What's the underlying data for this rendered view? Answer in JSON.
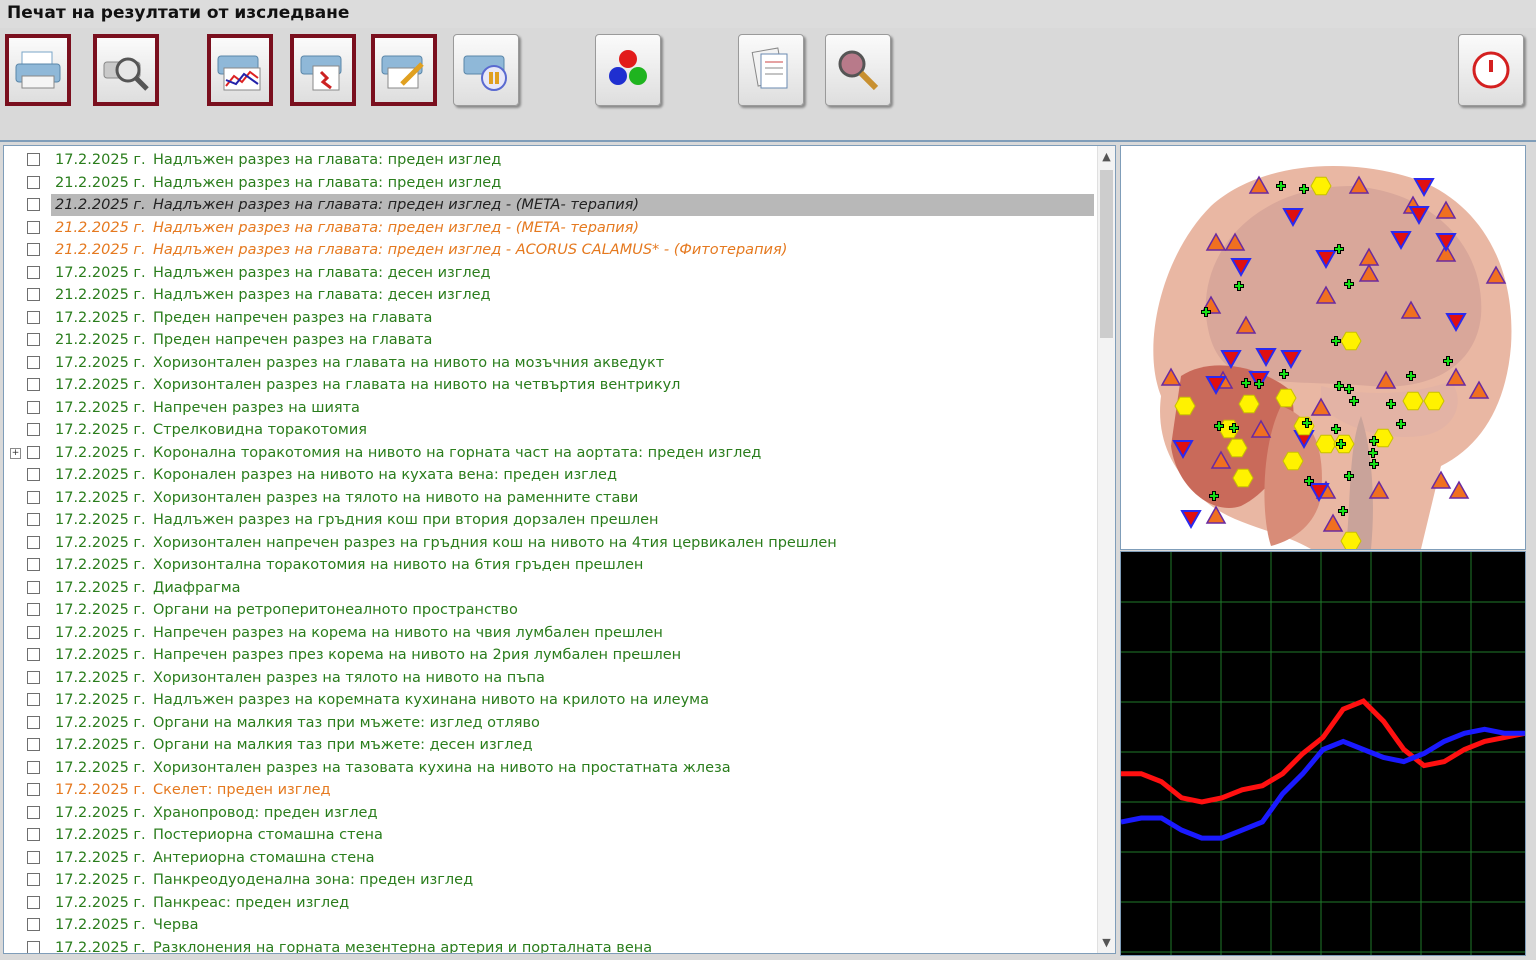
{
  "window": {
    "title": "Печат на резултати от изследване"
  },
  "toolbar": {
    "buttons": [
      {
        "name": "print-button",
        "icon": "printer-icon",
        "selected": true
      },
      {
        "name": "print-preview-button",
        "icon": "print-preview-icon",
        "selected": true
      },
      {
        "name": "print-chart-button",
        "icon": "print-chart-icon",
        "selected": true
      },
      {
        "name": "print-report-button",
        "icon": "print-report-icon",
        "selected": true
      },
      {
        "name": "print-edit-button",
        "icon": "print-edit-icon",
        "selected": true
      },
      {
        "name": "print-audio-button",
        "icon": "print-audio-icon",
        "selected": false
      },
      {
        "name": "color-spheres-button",
        "icon": "color-spheres-icon",
        "selected": false
      },
      {
        "name": "documents-button",
        "icon": "documents-icon",
        "selected": false
      },
      {
        "name": "search-button",
        "icon": "magnifier-icon",
        "selected": false
      },
      {
        "name": "exit-button",
        "icon": "power-icon",
        "selected": false
      }
    ]
  },
  "list": {
    "items": [
      {
        "date": "17.2.2025 г.",
        "label": "Надлъжен разрез на главата: преден изглед",
        "style": "green"
      },
      {
        "date": "21.2.2025 г.",
        "label": "Надлъжен разрез на главата: преден изглед",
        "style": "green"
      },
      {
        "date": "21.2.2025 г.",
        "label": "Надлъжен разрез на главата: преден изглед - (META- терапия)",
        "style": "selected"
      },
      {
        "date": "21.2.2025 г.",
        "label": "Надлъжен разрез на главата: преден изглед - (META- терапия)",
        "style": "orange"
      },
      {
        "date": "21.2.2025 г.",
        "label": "Надлъжен разрез на главата: преден изглед - ACORUS  CALAMUS* - (Фитотерапия)",
        "style": "orange"
      },
      {
        "date": "17.2.2025 г.",
        "label": "Надлъжен разрез на главата: десен изглед",
        "style": "green"
      },
      {
        "date": "21.2.2025 г.",
        "label": "Надлъжен разрез на главата: десен изглед",
        "style": "green"
      },
      {
        "date": "17.2.2025 г.",
        "label": "Преден напречен разрез на главата",
        "style": "green"
      },
      {
        "date": "21.2.2025 г.",
        "label": "Преден напречен разрез на главата",
        "style": "green"
      },
      {
        "date": "17.2.2025 г.",
        "label": "Хоризонтален разрез на главата на нивото на мозъчния акведукт",
        "style": "green"
      },
      {
        "date": "17.2.2025 г.",
        "label": "Хоризонтален разрез на главата на нивото на четвъртия вентрикул",
        "style": "green"
      },
      {
        "date": "17.2.2025 г.",
        "label": "Напречен разрез на шията",
        "style": "green"
      },
      {
        "date": "17.2.2025 г.",
        "label": "Стрелковидна торакотомия",
        "style": "green"
      },
      {
        "date": "17.2.2025 г.",
        "label": "Коронална торакотомия на нивото на горната част на аортата: преден изглед",
        "style": "green",
        "expand": "+"
      },
      {
        "date": "17.2.2025 г.",
        "label": "Коронален разрез на нивото на кухата вена: преден изглед",
        "style": "green"
      },
      {
        "date": "17.2.2025 г.",
        "label": "Хоризонтален разрез на тялото на нивото на раменните стави",
        "style": "green"
      },
      {
        "date": "17.2.2025 г.",
        "label": "Надлъжен разрез на гръдния кош при втория дорзален прешлен",
        "style": "green"
      },
      {
        "date": "17.2.2025 г.",
        "label": "Хоризонтален напречен разрез на гръдния кош на нивото на 4тия цервикален прешлен",
        "style": "green"
      },
      {
        "date": "17.2.2025 г.",
        "label": "Хоризонтална торакотомия на нивото на 6тия гръден прешлен",
        "style": "green"
      },
      {
        "date": "17.2.2025 г.",
        "label": "Диафрагма",
        "style": "green"
      },
      {
        "date": "17.2.2025 г.",
        "label": "Органи на ретроперитонеалното пространство",
        "style": "green"
      },
      {
        "date": "17.2.2025 г.",
        "label": "Напречен разрез на корема на нивото на чвия лумбален прешлен",
        "style": "green"
      },
      {
        "date": "17.2.2025 г.",
        "label": "Напречен разрез през корема на нивото на 2рия лумбален прешлен",
        "style": "green"
      },
      {
        "date": "17.2.2025 г.",
        "label": "Хоризонтален разрез на тялото на нивото на пъпа",
        "style": "green"
      },
      {
        "date": "17.2.2025 г.",
        "label": "Надлъжен разрез на коремната кухинана нивото на крилото на илеума",
        "style": "green"
      },
      {
        "date": "17.2.2025 г.",
        "label": "Органи на малкия таз при мъжете: изглед отляво",
        "style": "green"
      },
      {
        "date": "17.2.2025 г.",
        "label": "Органи на малкия таз при мъжете: десен изглед",
        "style": "green"
      },
      {
        "date": "17.2.2025 г.",
        "label": "Хоризонтален разрез на тазовата кухина на нивото на простатната жлеза",
        "style": "green"
      },
      {
        "date": "17.2.2025 г.",
        "label": "Скелет: преден изглед",
        "style": "orange-plain"
      },
      {
        "date": "17.2.2025 г.",
        "label": "Хранопровод: преден изглед",
        "style": "green"
      },
      {
        "date": "17.2.2025 г.",
        "label": "Постериорна стомашна стена",
        "style": "green"
      },
      {
        "date": "17.2.2025 г.",
        "label": "Антериорна стомашна стена",
        "style": "green"
      },
      {
        "date": "17.2.2025 г.",
        "label": "Панкреодуоденална зона: преден изглед",
        "style": "green"
      },
      {
        "date": "17.2.2025 г.",
        "label": "Панкреас: преден изглед",
        "style": "green"
      },
      {
        "date": "17.2.2025 г.",
        "label": "Черва",
        "style": "green"
      },
      {
        "date": "17.2.2025 г.",
        "label": "Разклонения на горната мезентерна артерия и порталната вена",
        "style": "green"
      }
    ]
  },
  "colors": {
    "green_text": "#2a7d1c",
    "orange_text": "#e5791f",
    "selection": "#b8b8b8",
    "grid": "#1f7a2a",
    "series_red": "#ff1010",
    "series_blue": "#1a1aff"
  },
  "chart_data": {
    "type": "line",
    "x": [
      0,
      1,
      2,
      3,
      4,
      5,
      6,
      7,
      8,
      9,
      10,
      11,
      12,
      13,
      14,
      15,
      16,
      17,
      18,
      19,
      20
    ],
    "series": [
      {
        "values": [
          45,
          45,
          43,
          39,
          38,
          39,
          41,
          42,
          45,
          50,
          54,
          61,
          63,
          58,
          51,
          47,
          48,
          51,
          53,
          54,
          55
        ]
      },
      {
        "values": [
          33,
          34,
          34,
          31,
          29,
          29,
          31,
          33,
          40,
          45,
          51,
          53,
          51,
          49,
          48,
          50,
          53,
          55,
          56,
          55,
          55
        ]
      }
    ],
    "ylim": [
      0,
      100
    ],
    "grid": true
  }
}
